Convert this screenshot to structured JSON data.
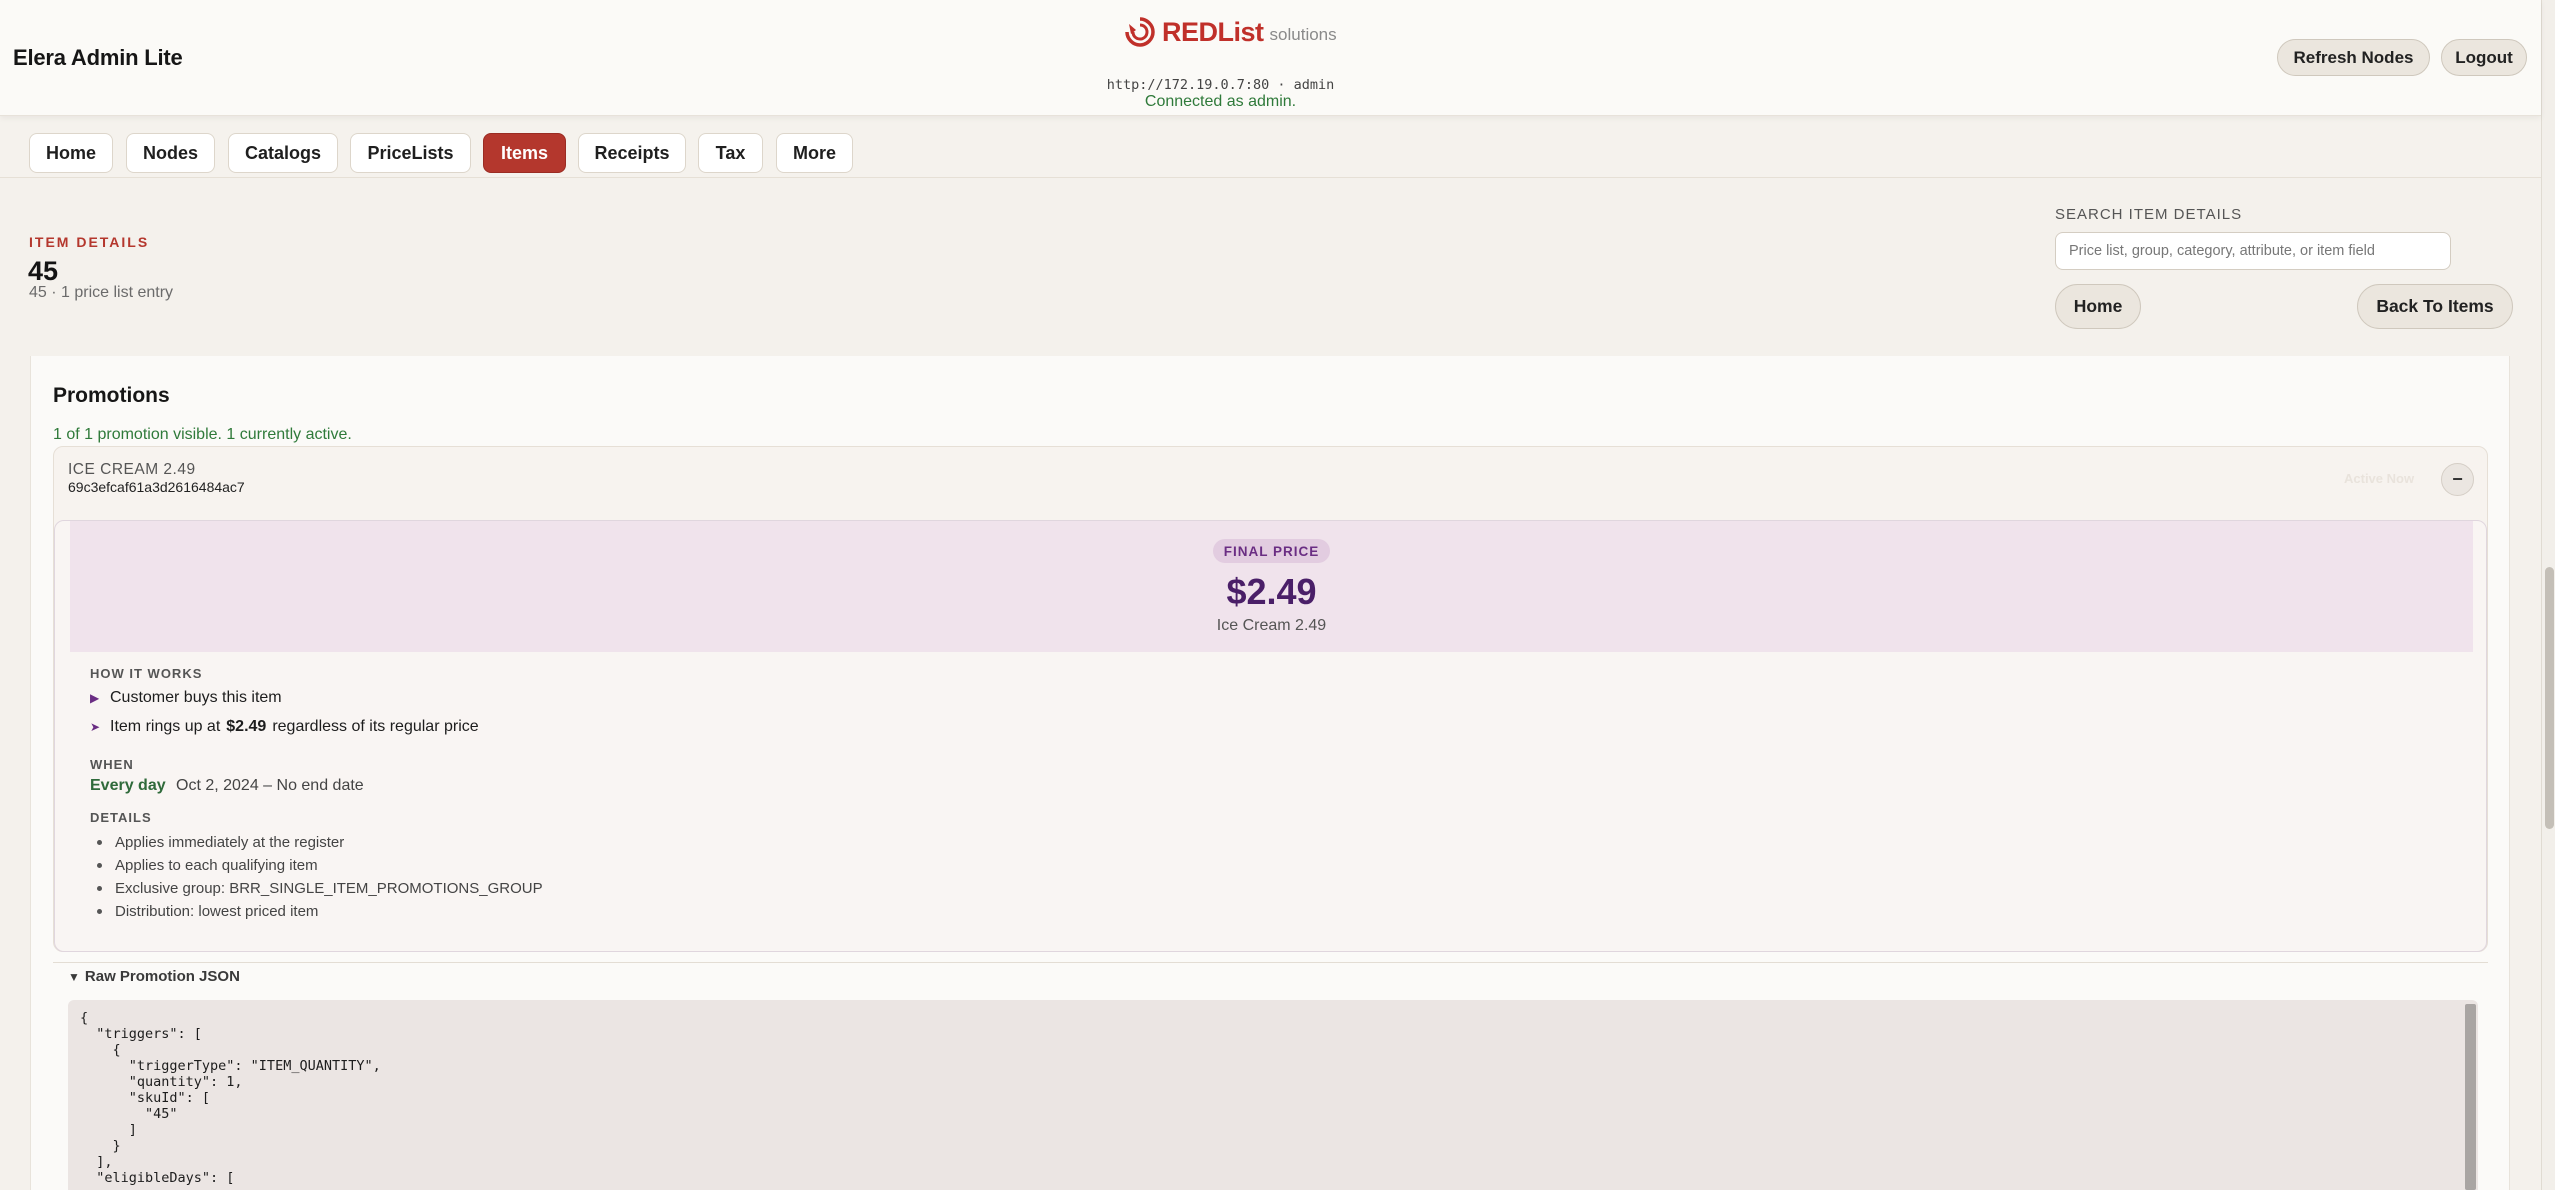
{
  "header": {
    "app_title": "Elera Admin Lite",
    "brand_red": "RED",
    "brand_list": "List",
    "brand_suffix": "solutions",
    "connection_url": "http://172.19.0.7:80 · admin",
    "connection_status": "Connected as admin.",
    "refresh_label": "Refresh Nodes",
    "logout_label": "Logout"
  },
  "nav": {
    "tabs": [
      {
        "label": "Home"
      },
      {
        "label": "Nodes"
      },
      {
        "label": "Catalogs"
      },
      {
        "label": "PriceLists"
      },
      {
        "label": "Items"
      },
      {
        "label": "Receipts"
      },
      {
        "label": "Tax"
      },
      {
        "label": "More"
      }
    ],
    "active": "Items"
  },
  "item": {
    "eyebrow": "ITEM DETAILS",
    "number": "45",
    "subtitle": "45 · 1 price list entry"
  },
  "search": {
    "label": "SEARCH ITEM DETAILS",
    "placeholder": "Price list, group, category, attribute, or item field",
    "home_label": "Home",
    "back_label": "Back To Items"
  },
  "promotions": {
    "title": "Promotions",
    "status": "1 of 1 promotion visible. 1 currently active.",
    "entry": {
      "name": "ICE CREAM 2.49",
      "id": "69c3efcaf61a3d2616484ac7",
      "faded_status": "Active Now",
      "collapse_label": "−",
      "badge": "FINAL PRICE",
      "price": "$2.49",
      "price_name": "Ice Cream 2.49",
      "how_label": "HOW IT WORKS",
      "how_step1": "Customer buys this item",
      "how_step2_pre": "Item rings up at",
      "how_step2_price": "$2.49",
      "how_step2_post": "regardless of its regular price",
      "when_label": "WHEN",
      "when_day": "Every day",
      "when_range": "Oct 2, 2024 – No end date",
      "details_label": "DETAILS",
      "details": [
        "Applies immediately at the register",
        "Applies to each qualifying item",
        "Exclusive group: BRR_SINGLE_ITEM_PROMOTIONS_GROUP",
        "Distribution: lowest priced item"
      ]
    },
    "raw_label": "Raw Promotion JSON",
    "raw_json": "{\n  \"triggers\": [\n    {\n      \"triggerType\": \"ITEM_QUANTITY\",\n      \"quantity\": 1,\n      \"skuId\": [\n        \"45\"\n      ]\n    }\n  ],\n  \"eligibleDays\": ["
  },
  "colors": {
    "accent": "#b4372d",
    "success": "#2f7a3a",
    "price_purple": "#4a1f68"
  }
}
